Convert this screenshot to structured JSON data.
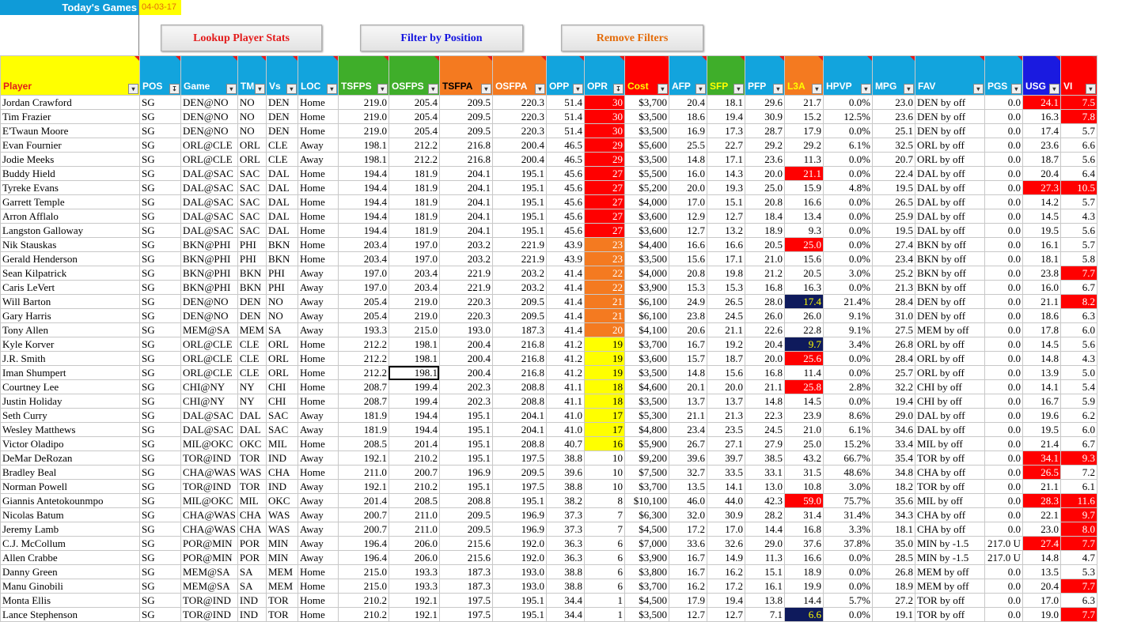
{
  "header": {
    "title": "Today's Games",
    "date": "04-03-17"
  },
  "buttons": {
    "lookup": "Lookup Player Stats",
    "filter": "Filter by Position",
    "remove": "Remove Filters"
  },
  "colors": {
    "red": "#ff0000",
    "orange": "#f47a20",
    "yellow": "#ffff00",
    "navy": "#0e1a5c",
    "headerBlue": "#12a4dd",
    "headerGreen": "#3fae2a",
    "headerOrange": "#f47a20"
  },
  "columns": [
    {
      "key": "Player",
      "bg": "#ffff00",
      "fg": "#e31b1b"
    },
    {
      "key": "POS",
      "bg": "#12a4dd",
      "fg": "#ffffff"
    },
    {
      "key": "Game",
      "bg": "#12a4dd",
      "fg": "#ffffff"
    },
    {
      "key": "TM",
      "bg": "#12a4dd",
      "fg": "#ffffff"
    },
    {
      "key": "Vs",
      "bg": "#12a4dd",
      "fg": "#ffffff"
    },
    {
      "key": "LOC",
      "bg": "#12a4dd",
      "fg": "#ffffff"
    },
    {
      "key": "TSFPS",
      "bg": "#3fae2a",
      "fg": "#ffffff"
    },
    {
      "key": "OSFPS",
      "bg": "#3fae2a",
      "fg": "#ffffff"
    },
    {
      "key": "TSFPA",
      "bg": "#f47a20",
      "fg": "#000000"
    },
    {
      "key": "OSFPA",
      "bg": "#f47a20",
      "fg": "#ffffff"
    },
    {
      "key": "OPP",
      "bg": "#12a4dd",
      "fg": "#ffffff"
    },
    {
      "key": "OPR",
      "bg": "#12a4dd",
      "fg": "#ffffff"
    },
    {
      "key": "Cost",
      "bg": "#ff0000",
      "fg": "#ffff00"
    },
    {
      "key": "AFP",
      "bg": "#12a4dd",
      "fg": "#ffffff"
    },
    {
      "key": "SFP",
      "bg": "#3fae2a",
      "fg": "#ffff00"
    },
    {
      "key": "PFP",
      "bg": "#12a4dd",
      "fg": "#ffffff"
    },
    {
      "key": "L3A",
      "bg": "#f47a20",
      "fg": "#ffff00"
    },
    {
      "key": "HPVP",
      "bg": "#12a4dd",
      "fg": "#ffffff"
    },
    {
      "key": "MPG",
      "bg": "#12a4dd",
      "fg": "#ffffff"
    },
    {
      "key": "FAV",
      "bg": "#12a4dd",
      "fg": "#ffffff"
    },
    {
      "key": "PGS",
      "bg": "#12a4dd",
      "fg": "#ffffff"
    },
    {
      "key": "USG",
      "bg": "#1a1ae0",
      "fg": "#ffffff"
    },
    {
      "key": "VI",
      "bg": "#ff0000",
      "fg": "#ffffff"
    }
  ],
  "rows": [
    [
      "Jordan Crawford",
      "SG",
      "DEN@NO",
      "NO",
      "DEN",
      "Home",
      "219.0",
      "205.4",
      "209.5",
      "220.3",
      "51.4",
      "30",
      "$3,700",
      "20.4",
      "18.1",
      "29.6",
      "21.7",
      "0.0%",
      "23.0",
      "DEN by off",
      "0.0",
      "24.1",
      "7.5"
    ],
    [
      "Tim Frazier",
      "SG",
      "DEN@NO",
      "NO",
      "DEN",
      "Home",
      "219.0",
      "205.4",
      "209.5",
      "220.3",
      "51.4",
      "30",
      "$3,500",
      "18.6",
      "19.4",
      "30.9",
      "15.2",
      "12.5%",
      "23.6",
      "DEN by off",
      "0.0",
      "16.3",
      "7.8"
    ],
    [
      "E'Twaun Moore",
      "SG",
      "DEN@NO",
      "NO",
      "DEN",
      "Home",
      "219.0",
      "205.4",
      "209.5",
      "220.3",
      "51.4",
      "30",
      "$3,500",
      "16.9",
      "17.3",
      "28.7",
      "17.9",
      "0.0%",
      "25.1",
      "DEN by off",
      "0.0",
      "17.4",
      "5.7"
    ],
    [
      "Evan Fournier",
      "SG",
      "ORL@CLE",
      "ORL",
      "CLE",
      "Away",
      "198.1",
      "212.2",
      "216.8",
      "200.4",
      "46.5",
      "29",
      "$5,600",
      "25.5",
      "22.7",
      "29.2",
      "29.2",
      "6.1%",
      "32.5",
      "ORL by off",
      "0.0",
      "23.6",
      "6.6"
    ],
    [
      "Jodie Meeks",
      "SG",
      "ORL@CLE",
      "ORL",
      "CLE",
      "Away",
      "198.1",
      "212.2",
      "216.8",
      "200.4",
      "46.5",
      "29",
      "$3,500",
      "14.8",
      "17.1",
      "23.6",
      "11.3",
      "0.0%",
      "20.7",
      "ORL by off",
      "0.0",
      "18.7",
      "5.6"
    ],
    [
      "Buddy Hield",
      "SG",
      "DAL@SAC",
      "SAC",
      "DAL",
      "Home",
      "194.4",
      "181.9",
      "204.1",
      "195.1",
      "45.6",
      "27",
      "$5,500",
      "16.0",
      "14.3",
      "20.0",
      "21.1",
      "0.0%",
      "22.4",
      "DAL by off",
      "0.0",
      "20.4",
      "6.4"
    ],
    [
      "Tyreke Evans",
      "SG",
      "DAL@SAC",
      "SAC",
      "DAL",
      "Home",
      "194.4",
      "181.9",
      "204.1",
      "195.1",
      "45.6",
      "27",
      "$5,200",
      "20.0",
      "19.3",
      "25.0",
      "15.9",
      "4.8%",
      "19.5",
      "DAL by off",
      "0.0",
      "27.3",
      "10.5"
    ],
    [
      "Garrett Temple",
      "SG",
      "DAL@SAC",
      "SAC",
      "DAL",
      "Home",
      "194.4",
      "181.9",
      "204.1",
      "195.1",
      "45.6",
      "27",
      "$4,000",
      "17.0",
      "15.1",
      "20.8",
      "16.6",
      "0.0%",
      "26.5",
      "DAL by off",
      "0.0",
      "14.2",
      "5.7"
    ],
    [
      "Arron Afflalo",
      "SG",
      "DAL@SAC",
      "SAC",
      "DAL",
      "Home",
      "194.4",
      "181.9",
      "204.1",
      "195.1",
      "45.6",
      "27",
      "$3,600",
      "12.9",
      "12.7",
      "18.4",
      "13.4",
      "0.0%",
      "25.9",
      "DAL by off",
      "0.0",
      "14.5",
      "4.3"
    ],
    [
      "Langston Galloway",
      "SG",
      "DAL@SAC",
      "SAC",
      "DAL",
      "Home",
      "194.4",
      "181.9",
      "204.1",
      "195.1",
      "45.6",
      "27",
      "$3,600",
      "12.7",
      "13.2",
      "18.9",
      "9.3",
      "0.0%",
      "19.5",
      "DAL by off",
      "0.0",
      "19.5",
      "5.6"
    ],
    [
      "Nik Stauskas",
      "SG",
      "BKN@PHI",
      "PHI",
      "BKN",
      "Home",
      "203.4",
      "197.0",
      "203.2",
      "221.9",
      "43.9",
      "23",
      "$4,400",
      "16.6",
      "16.6",
      "20.5",
      "25.0",
      "0.0%",
      "27.4",
      "BKN by off",
      "0.0",
      "16.1",
      "5.7"
    ],
    [
      "Gerald Henderson",
      "SG",
      "BKN@PHI",
      "PHI",
      "BKN",
      "Home",
      "203.4",
      "197.0",
      "203.2",
      "221.9",
      "43.9",
      "23",
      "$3,500",
      "15.6",
      "17.1",
      "21.0",
      "15.6",
      "0.0%",
      "23.4",
      "BKN by off",
      "0.0",
      "18.1",
      "5.8"
    ],
    [
      "Sean Kilpatrick",
      "SG",
      "BKN@PHI",
      "BKN",
      "PHI",
      "Away",
      "197.0",
      "203.4",
      "221.9",
      "203.2",
      "41.4",
      "22",
      "$4,000",
      "20.8",
      "19.8",
      "21.2",
      "20.5",
      "3.0%",
      "25.2",
      "BKN by off",
      "0.0",
      "23.8",
      "7.7"
    ],
    [
      "Caris LeVert",
      "SG",
      "BKN@PHI",
      "BKN",
      "PHI",
      "Away",
      "197.0",
      "203.4",
      "221.9",
      "203.2",
      "41.4",
      "22",
      "$3,900",
      "15.3",
      "15.3",
      "16.8",
      "16.3",
      "0.0%",
      "21.3",
      "BKN by off",
      "0.0",
      "16.0",
      "6.7"
    ],
    [
      "Will Barton",
      "SG",
      "DEN@NO",
      "DEN",
      "NO",
      "Away",
      "205.4",
      "219.0",
      "220.3",
      "209.5",
      "41.4",
      "21",
      "$6,100",
      "24.9",
      "26.5",
      "28.0",
      "17.4",
      "21.4%",
      "28.4",
      "DEN by off",
      "0.0",
      "21.1",
      "8.2"
    ],
    [
      "Gary Harris",
      "SG",
      "DEN@NO",
      "DEN",
      "NO",
      "Away",
      "205.4",
      "219.0",
      "220.3",
      "209.5",
      "41.4",
      "21",
      "$6,100",
      "23.8",
      "24.5",
      "26.0",
      "26.0",
      "9.1%",
      "31.0",
      "DEN by off",
      "0.0",
      "18.6",
      "6.3"
    ],
    [
      "Tony Allen",
      "SG",
      "MEM@SA",
      "MEM",
      "SA",
      "Away",
      "193.3",
      "215.0",
      "193.0",
      "187.3",
      "41.4",
      "20",
      "$4,100",
      "20.6",
      "21.1",
      "22.6",
      "22.8",
      "9.1%",
      "27.5",
      "MEM by off",
      "0.0",
      "17.8",
      "6.0"
    ],
    [
      "Kyle Korver",
      "SG",
      "ORL@CLE",
      "CLE",
      "ORL",
      "Home",
      "212.2",
      "198.1",
      "200.4",
      "216.8",
      "41.2",
      "19",
      "$3,700",
      "16.7",
      "19.2",
      "20.4",
      "9.7",
      "3.4%",
      "26.8",
      "ORL by off",
      "0.0",
      "14.5",
      "5.6"
    ],
    [
      "J.R. Smith",
      "SG",
      "ORL@CLE",
      "CLE",
      "ORL",
      "Home",
      "212.2",
      "198.1",
      "200.4",
      "216.8",
      "41.2",
      "19",
      "$3,600",
      "15.7",
      "18.7",
      "20.0",
      "25.6",
      "0.0%",
      "28.4",
      "ORL by off",
      "0.0",
      "14.8",
      "4.3"
    ],
    [
      "Iman Shumpert",
      "SG",
      "ORL@CLE",
      "CLE",
      "ORL",
      "Home",
      "212.2",
      "198.1",
      "200.4",
      "216.8",
      "41.2",
      "19",
      "$3,500",
      "14.8",
      "15.6",
      "16.8",
      "11.4",
      "0.0%",
      "25.7",
      "ORL by off",
      "0.0",
      "13.9",
      "5.0"
    ],
    [
      "Courtney Lee",
      "SG",
      "CHI@NY",
      "NY",
      "CHI",
      "Home",
      "208.7",
      "199.4",
      "202.3",
      "208.8",
      "41.1",
      "18",
      "$4,600",
      "20.1",
      "20.0",
      "21.1",
      "25.8",
      "2.8%",
      "32.2",
      "CHI by off",
      "0.0",
      "14.1",
      "5.4"
    ],
    [
      "Justin Holiday",
      "SG",
      "CHI@NY",
      "NY",
      "CHI",
      "Home",
      "208.7",
      "199.4",
      "202.3",
      "208.8",
      "41.1",
      "18",
      "$3,500",
      "13.7",
      "13.7",
      "14.8",
      "14.5",
      "0.0%",
      "19.4",
      "CHI by off",
      "0.0",
      "16.7",
      "5.9"
    ],
    [
      "Seth Curry",
      "SG",
      "DAL@SAC",
      "DAL",
      "SAC",
      "Away",
      "181.9",
      "194.4",
      "195.1",
      "204.1",
      "41.0",
      "17",
      "$5,300",
      "21.1",
      "21.3",
      "22.3",
      "23.9",
      "8.6%",
      "29.0",
      "DAL by off",
      "0.0",
      "19.6",
      "6.2"
    ],
    [
      "Wesley Matthews",
      "SG",
      "DAL@SAC",
      "DAL",
      "SAC",
      "Away",
      "181.9",
      "194.4",
      "195.1",
      "204.1",
      "41.0",
      "17",
      "$4,800",
      "23.4",
      "23.5",
      "24.5",
      "21.0",
      "6.1%",
      "34.6",
      "DAL by off",
      "0.0",
      "19.5",
      "6.0"
    ],
    [
      "Victor Oladipo",
      "SG",
      "MIL@OKC",
      "OKC",
      "MIL",
      "Home",
      "208.5",
      "201.4",
      "195.1",
      "208.8",
      "40.7",
      "16",
      "$5,900",
      "26.7",
      "27.1",
      "27.9",
      "25.0",
      "15.2%",
      "33.4",
      "MIL by off",
      "0.0",
      "21.4",
      "6.7"
    ],
    [
      "DeMar DeRozan",
      "SG",
      "TOR@IND",
      "TOR",
      "IND",
      "Away",
      "192.1",
      "210.2",
      "195.1",
      "197.5",
      "38.8",
      "10",
      "$9,200",
      "39.6",
      "39.7",
      "38.5",
      "43.2",
      "66.7%",
      "35.4",
      "TOR by off",
      "0.0",
      "34.1",
      "9.3"
    ],
    [
      "Bradley Beal",
      "SG",
      "CHA@WAS",
      "WAS",
      "CHA",
      "Home",
      "211.0",
      "200.7",
      "196.9",
      "209.5",
      "39.6",
      "10",
      "$7,500",
      "32.7",
      "33.5",
      "33.1",
      "31.5",
      "48.6%",
      "34.8",
      "CHA by off",
      "0.0",
      "26.5",
      "7.2"
    ],
    [
      "Norman Powell",
      "SG",
      "TOR@IND",
      "TOR",
      "IND",
      "Away",
      "192.1",
      "210.2",
      "195.1",
      "197.5",
      "38.8",
      "10",
      "$3,700",
      "13.5",
      "14.1",
      "13.0",
      "10.8",
      "3.0%",
      "18.2",
      "TOR by off",
      "0.0",
      "21.1",
      "6.1"
    ],
    [
      "Giannis Antetokounmpo",
      "SG",
      "MIL@OKC",
      "MIL",
      "OKC",
      "Away",
      "201.4",
      "208.5",
      "208.8",
      "195.1",
      "38.2",
      "8",
      "$10,100",
      "46.0",
      "44.0",
      "42.3",
      "59.0",
      "75.7%",
      "35.6",
      "MIL by off",
      "0.0",
      "28.3",
      "11.6"
    ],
    [
      "Nicolas Batum",
      "SG",
      "CHA@WAS",
      "CHA",
      "WAS",
      "Away",
      "200.7",
      "211.0",
      "209.5",
      "196.9",
      "37.3",
      "7",
      "$6,300",
      "32.0",
      "30.9",
      "28.2",
      "31.4",
      "31.4%",
      "34.3",
      "CHA by off",
      "0.0",
      "22.1",
      "9.7"
    ],
    [
      "Jeremy Lamb",
      "SG",
      "CHA@WAS",
      "CHA",
      "WAS",
      "Away",
      "200.7",
      "211.0",
      "209.5",
      "196.9",
      "37.3",
      "7",
      "$4,500",
      "17.2",
      "17.0",
      "14.4",
      "16.8",
      "3.3%",
      "18.1",
      "CHA by off",
      "0.0",
      "23.0",
      "8.0"
    ],
    [
      "C.J. McCollum",
      "SG",
      "POR@MIN",
      "POR",
      "MIN",
      "Away",
      "196.4",
      "206.0",
      "215.6",
      "192.0",
      "36.3",
      "6",
      "$7,000",
      "33.6",
      "32.6",
      "29.0",
      "37.6",
      "37.8%",
      "35.0",
      "MIN by -1.5",
      "217.0 U",
      "27.4",
      "7.7"
    ],
    [
      "Allen Crabbe",
      "SG",
      "POR@MIN",
      "POR",
      "MIN",
      "Away",
      "196.4",
      "206.0",
      "215.6",
      "192.0",
      "36.3",
      "6",
      "$3,900",
      "16.7",
      "14.9",
      "11.3",
      "16.6",
      "0.0%",
      "28.5",
      "MIN by -1.5",
      "217.0 U",
      "14.8",
      "4.7"
    ],
    [
      "Danny Green",
      "SG",
      "MEM@SA",
      "SA",
      "MEM",
      "Home",
      "215.0",
      "193.3",
      "187.3",
      "193.0",
      "38.8",
      "6",
      "$3,800",
      "16.7",
      "16.2",
      "15.1",
      "18.9",
      "0.0%",
      "26.8",
      "MEM by off",
      "0.0",
      "13.5",
      "5.3"
    ],
    [
      "Manu Ginobili",
      "SG",
      "MEM@SA",
      "SA",
      "MEM",
      "Home",
      "215.0",
      "193.3",
      "187.3",
      "193.0",
      "38.8",
      "6",
      "$3,700",
      "16.2",
      "17.2",
      "16.1",
      "19.9",
      "0.0%",
      "18.9",
      "MEM by off",
      "0.0",
      "20.4",
      "7.7"
    ],
    [
      "Monta Ellis",
      "SG",
      "TOR@IND",
      "IND",
      "TOR",
      "Home",
      "210.2",
      "192.1",
      "197.5",
      "195.1",
      "34.4",
      "1",
      "$4,500",
      "17.9",
      "19.4",
      "13.8",
      "14.4",
      "5.7%",
      "27.2",
      "TOR by off",
      "0.0",
      "17.0",
      "6.3"
    ],
    [
      "Lance Stephenson",
      "SG",
      "TOR@IND",
      "IND",
      "TOR",
      "Home",
      "210.2",
      "192.1",
      "197.5",
      "195.1",
      "34.4",
      "1",
      "$3,500",
      "12.7",
      "12.7",
      "7.1",
      "6.6",
      "0.0%",
      "19.1",
      "TOR by off",
      "0.0",
      "19.0",
      "7.7"
    ]
  ]
}
